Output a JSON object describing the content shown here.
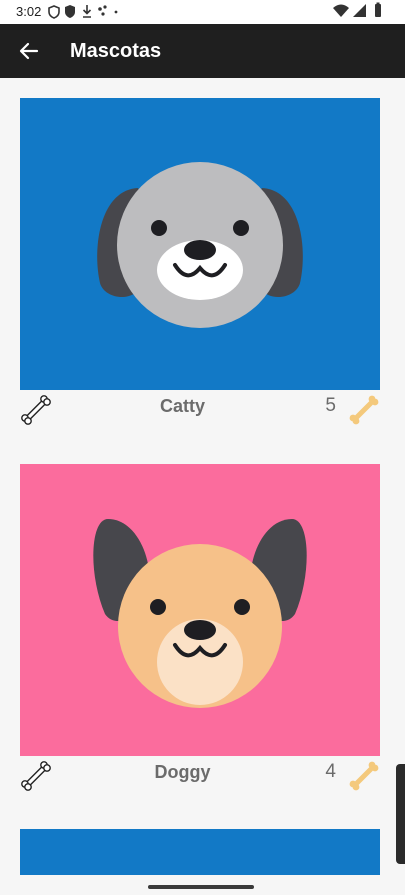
{
  "status_bar": {
    "time": "3:02",
    "left_icons": [
      "vpn-icon",
      "shield-icon",
      "download-icon",
      "dots-icon"
    ],
    "right_icons": [
      "wifi-icon",
      "signal-icon",
      "battery-icon"
    ]
  },
  "app_bar": {
    "title": "Mascotas",
    "back_icon": "arrow-back-icon"
  },
  "pets": [
    {
      "name": "Catty",
      "count": "5",
      "bg_color": "#1279c6",
      "face_color": "#bdbdbf",
      "ear_color": "#47474c"
    },
    {
      "name": "Doggy",
      "count": "4",
      "bg_color": "#fb6c9d",
      "face_color": "#f6c189",
      "ear_color": "#47474c"
    }
  ],
  "partial_pet": {
    "bg_color": "#1279c6"
  },
  "colors": {
    "app_bar": "#1f1f1f",
    "background": "#f6f6f6",
    "bone_active": "#f4c97c",
    "bone_inactive": "#222222"
  }
}
